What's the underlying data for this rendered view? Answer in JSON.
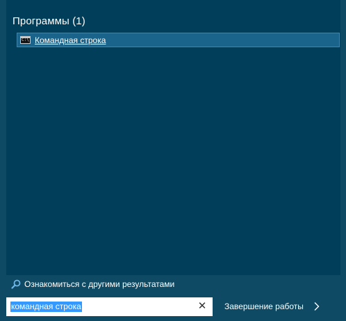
{
  "results": {
    "group_title": "Программы (1)",
    "items": [
      {
        "label": "Командная строка",
        "icon": "cmd-icon"
      }
    ]
  },
  "more_results": {
    "label": "Ознакомиться с другими результатами",
    "icon": "search-icon"
  },
  "search": {
    "value": "командная строка",
    "clear_icon": "clear-icon"
  },
  "power": {
    "label": "Завершение работы",
    "icon": "chevron-right-icon"
  },
  "colors": {
    "background": "#0e4a63",
    "results_panel": "#003e59",
    "selected_item": "#1a638a",
    "selection_highlight": "#3399ff"
  }
}
